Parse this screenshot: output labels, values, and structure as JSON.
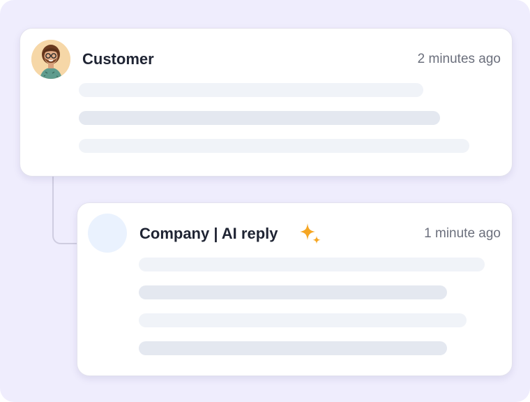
{
  "customer_message": {
    "title": "Customer",
    "timestamp": "2 minutes ago",
    "avatar_icon": "customer-avatar"
  },
  "company_reply": {
    "title": "Company | AI reply",
    "timestamp": "1 minute ago",
    "avatar_icon": "company-avatar",
    "badge_icon": "sparkle-icon",
    "badge_color": "#f5a623"
  },
  "colors": {
    "background": "#efedfd",
    "card": "#ffffff",
    "text_primary": "#1f2433",
    "text_secondary": "#6b6f7c",
    "placeholder_light": "#f0f3f8",
    "placeholder_mid": "#e4e8f0"
  }
}
